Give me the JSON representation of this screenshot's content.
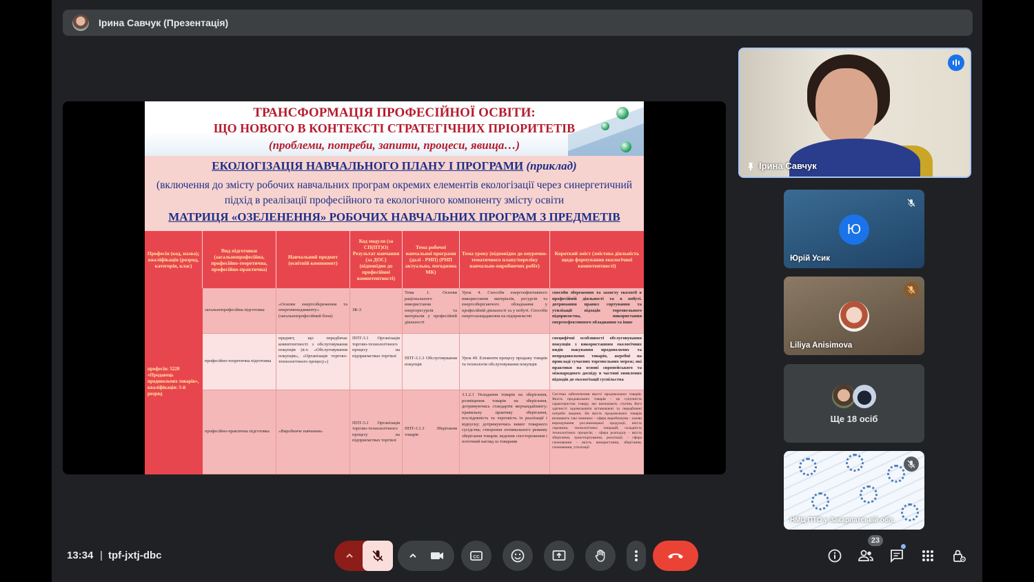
{
  "header": {
    "presenter_label": "Ірина Савчук (Презентація)"
  },
  "slide": {
    "head_line1": "ТРАНСФОРМАЦІЯ ПРОФЕСІЙНОЇ ОСВІТИ:",
    "head_line2": "ЩО НОВОГО В КОНТЕКСТІ СТРАТЕГІЧНИХ ПРІОРИТЕТІВ",
    "head_line3": "(проблеми, потреби, запити, процеси, явища…)",
    "title_main": "ЕКОЛОГІЗАЦІЯ НАВЧАЛЬНОГО ПЛАНУ І ПРОГРАМИ",
    "title_note": " (приклад)",
    "body": "(включення до змісту робочих навчальних програм окремих елементів екологізації через синергетичний підхід в реалізації професійного та екологічного компоненту змісту освіти",
    "matrix_title": "МАТРИЦЯ «ОЗЕЛЕНЕННЯ» РОБОЧИХ НАВЧАЛЬНИХ ПРОГРАМ З ПРЕДМЕТІВ",
    "table_headers": [
      "Професія (код, назва); кваліфікація (розряд, категорія, клас)",
      "Вид підготовки (загальнопрофесійна, професійно-теоретична, професійно-практична)",
      "Навчальний предмет (освітній компонент)",
      "Код модуля (за СП(ПТ)О) Результат навчання (за ДОС) (відповідно до професійної компетентності)",
      "Тема робочої навчальної програми (далі - РНП) (РНП актуальна, погоджена МК)",
      "Тема уроку (відповідно до поурочно-тематичного плану/переліку навчально-виробничих робіт)",
      "Короткий зміст (змістова діяльність щодо формування екологічної компетентності)"
    ],
    "profession_cell": "професія: 5220 «Продавець продовольчих товарів», кваліфікація: 3-й розряд",
    "rows": [
      {
        "type": "загальнопрофесійна підготовка",
        "subject": "«Основи енергозбереження та енергоменеджменту» (загальнопрофесійний блок)",
        "module": "ЗК-3",
        "topic": "Тема 1. Основи раціонального використання енергоресурсів та матеріалів у професійній діяльності",
        "lesson": "Урок 4. Способи енергоефективного використання матеріалів, ресурсів та енергозберігаючого обладнання у професійній діяльності та у побуті. Способи енергозаощадження на підприємстві",
        "content": "способи збереження та захисту екології в професійній діяльності та в побуті. дотримання правил сортування та утилізації відходів торговельного підприємства, використання енергоефективного обладнання та інше"
      },
      {
        "type": "професійно-теоретична підготовка",
        "subject": "предмет, що передбачає компетентності з обслуговування покупців (в.ч. «Обслуговування покупців», «Організація торгово-технологічного процесу»)",
        "module": "ППТ-3.1 Організація торгово-технологічного процесу на підприємствах торгівлі",
        "topic": "ППТ-3.1.3 Обслуговування покупців",
        "lesson": "Урок 49. Елементи процесу продажу товарів та технологія обслуговування покупців",
        "content": "специфічні особливості обслуговування покупців з використанням екологічних видів пакування продовольчих та непродовольчих товарів, жеребні на прикладі сучасних торговельних мереж; які практики на основі європейського та міжнародного досвіду в частині оновлених підходів до екологізації суспільства"
      },
      {
        "type": "професійно-практична підготовка",
        "subject": "«Виробниче навчання»",
        "module": "ППТ-3.1 Організація торгово-технологічного процесу на підприємствах торгівлі",
        "topic": "ППТ-3.1.3 Зберігання товарів",
        "lesson": "3.1.2.1 Укладання товарів на зберігання, розміщення товарів на зберігання, дотримуючись стандартів мерчандайзингу; правильну практику зберігання, послідовність та черговість їх реалізації і відпуску; дотримуючись вимог товарного сусідства; створення оптимального режиму зберігання товарів; ведення спостереження і поточний нагляд за товарами",
        "content": "Система забезпечення якості продовольчих товарів. Якість продовольчих товарів - це сукупність характеристик товару, які визначають ступінь його здатності задовольняти встановлені та передбачені потреби людини. На якість продовольчих товарів впливають такі чинники: - сфера виробництва - умови вирощування рослинницької продукції, якість сировини, технологічних операцій, складність технологічних процесів; - сфера розподілу - якість зберігання, транспортування, реалізації; - сфера споживання - якість використання, зберігання, споживання, утилізації"
      }
    ]
  },
  "participants": {
    "main_speaker": "Ірина Савчук",
    "tile1_name": "Юрій Усик",
    "tile1_initial": "Ю",
    "tile2_name": "Liliya Anisimova",
    "more_label": "Ще 18 осіб",
    "tile4_name": "НМЦ ПТО у Закарпатській обл."
  },
  "bottom_bar": {
    "time": "13:34",
    "separator": "|",
    "meeting_code": "tpf-jxtj-dbc",
    "people_count": "23"
  },
  "colors": {
    "accent": "#1a73e8",
    "end_call": "#ea4335",
    "mic_off_bg": "#f9dedc",
    "slide_red": "#e8464f",
    "slide_blue": "#1d2f86"
  },
  "icons": [
    "mic-off-icon",
    "camera-icon",
    "captions-icon",
    "emoji-icon",
    "present-icon",
    "raise-hand-icon",
    "more-options-icon",
    "end-call-icon",
    "info-icon",
    "people-icon",
    "chat-icon",
    "activities-icon",
    "host-controls-icon"
  ]
}
